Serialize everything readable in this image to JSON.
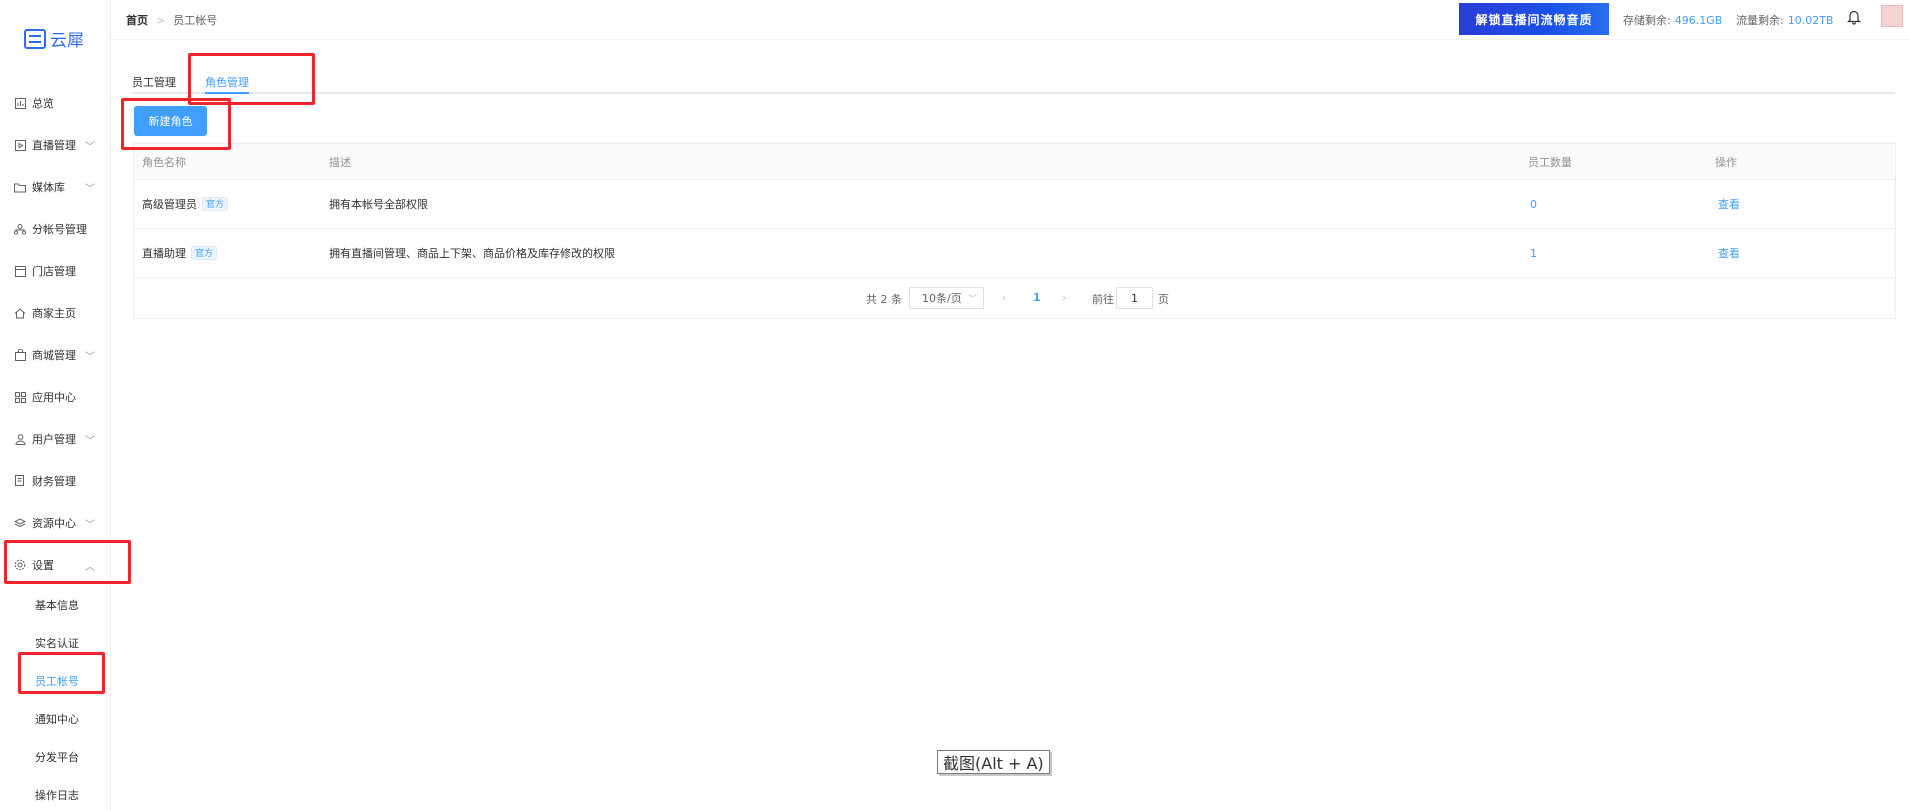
{
  "sidebar": {
    "logo_text": "云犀",
    "items": [
      {
        "label": "总览",
        "icon": "chart-icon",
        "has_chevron": false
      },
      {
        "label": "直播管理",
        "icon": "play-icon",
        "has_chevron": true
      },
      {
        "label": "媒体库",
        "icon": "folder-icon",
        "has_chevron": true
      },
      {
        "label": "分帐号管理",
        "icon": "hierarchy-icon",
        "has_chevron": false
      },
      {
        "label": "门店管理",
        "icon": "store-icon",
        "has_chevron": false
      },
      {
        "label": "商家主页",
        "icon": "home-icon",
        "has_chevron": false
      },
      {
        "label": "商城管理",
        "icon": "bag-icon",
        "has_chevron": true
      },
      {
        "label": "应用中心",
        "icon": "grid-icon",
        "has_chevron": false
      },
      {
        "label": "用户管理",
        "icon": "user-icon",
        "has_chevron": true
      },
      {
        "label": "财务管理",
        "icon": "finance-icon",
        "has_chevron": false
      },
      {
        "label": "资源中心",
        "icon": "layers-icon",
        "has_chevron": true
      },
      {
        "label": "设置",
        "icon": "gear-icon",
        "has_chevron": true,
        "expanded": true
      }
    ],
    "settings_sub": [
      {
        "label": "基本信息",
        "active": false
      },
      {
        "label": "实名认证",
        "active": false
      },
      {
        "label": "员工帐号",
        "active": true
      },
      {
        "label": "通知中心",
        "active": false
      },
      {
        "label": "分发平台",
        "active": false
      },
      {
        "label": "操作日志",
        "active": false
      }
    ]
  },
  "header": {
    "breadcrumb_home": "首页",
    "breadcrumb_current": "员工帐号",
    "banner_text": "解锁直播间流畅音质",
    "storage_label": "存储剩余:",
    "storage_value": "496.1GB",
    "traffic_label": "流量剩余:",
    "traffic_value": "10.02TB"
  },
  "tabs": [
    {
      "label": "员工管理",
      "active": false
    },
    {
      "label": "角色管理",
      "active": true
    }
  ],
  "new_role_button": "新建角色",
  "table": {
    "columns": [
      "角色名称",
      "描述",
      "员工数量",
      "操作"
    ],
    "rows": [
      {
        "name": "高级管理员",
        "tag": "官方",
        "desc": "拥有本帐号全部权限",
        "count": "0",
        "action": "查看"
      },
      {
        "name": "直播助理",
        "tag": "官方",
        "desc": "拥有直播间管理、商品上下架、商品价格及库存修改的权限",
        "count": "1",
        "action": "查看"
      }
    ]
  },
  "pagination": {
    "total_text": "共 2 条",
    "page_size": "10条/页",
    "current_page": "1",
    "goto_label": "前往",
    "goto_value": "1",
    "page_suffix": "页"
  },
  "screenshot_tip": "截图(Alt + A)",
  "colors": {
    "accent": "#409eff",
    "annotation_red": "#f0242c",
    "brand": "#2c6cf5"
  }
}
